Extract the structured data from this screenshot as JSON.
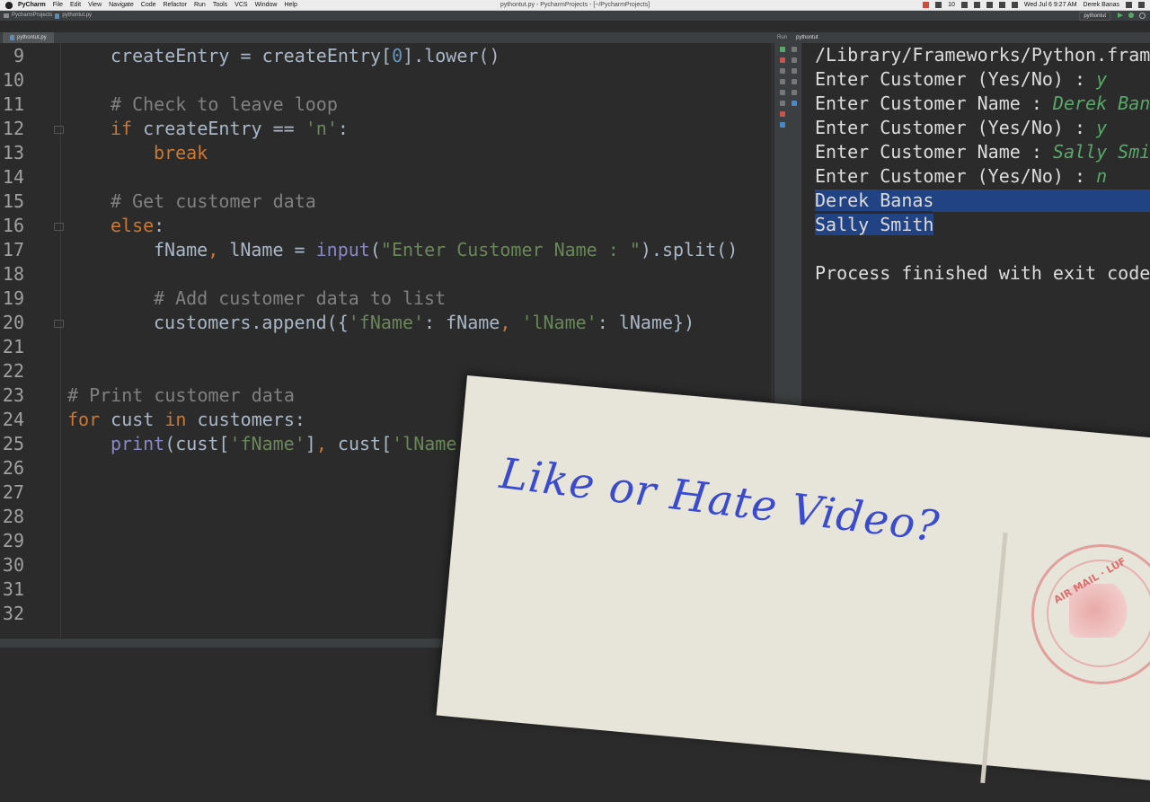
{
  "menubar": {
    "app": "PyCharm",
    "menus": [
      "File",
      "Edit",
      "View",
      "Navigate",
      "Code",
      "Refactor",
      "Run",
      "Tools",
      "VCS",
      "Window",
      "Help"
    ],
    "window_title": "pythontut.py - PycharmProjects - [~/PycharmProjects]",
    "battery_count": "10",
    "datetime": "Wed Jul 6  9:27 AM",
    "user": "Derek Banas"
  },
  "navbar": {
    "project": "PycharmProjects",
    "file": "pythontut.py",
    "run_config": "pythontut"
  },
  "editor": {
    "tab": "pythontut.py",
    "lines": [
      {
        "n": "9",
        "indent": 1,
        "tokens": [
          [
            "plain",
            "createEntry = createEntry["
          ],
          [
            "num",
            "0"
          ],
          [
            "plain",
            "].lower()"
          ]
        ]
      },
      {
        "n": "10",
        "indent": 0,
        "tokens": []
      },
      {
        "n": "11",
        "indent": 1,
        "tokens": [
          [
            "cm",
            "# Check to leave loop"
          ]
        ]
      },
      {
        "n": "12",
        "indent": 1,
        "tokens": [
          [
            "kw",
            "if "
          ],
          [
            "plain",
            "createEntry == "
          ],
          [
            "str",
            "'n'"
          ],
          [
            "plain",
            ":"
          ]
        ]
      },
      {
        "n": "13",
        "indent": 2,
        "tokens": [
          [
            "kw",
            "break"
          ]
        ]
      },
      {
        "n": "14",
        "indent": 0,
        "tokens": []
      },
      {
        "n": "15",
        "indent": 1,
        "tokens": [
          [
            "cm",
            "# Get customer data"
          ]
        ]
      },
      {
        "n": "16",
        "indent": 1,
        "tokens": [
          [
            "kw",
            "else"
          ],
          [
            "plain",
            ":"
          ]
        ]
      },
      {
        "n": "17",
        "indent": 2,
        "tokens": [
          [
            "plain",
            "fName"
          ],
          [
            "kw",
            ", "
          ],
          [
            "plain",
            "lName = "
          ],
          [
            "bi",
            "input"
          ],
          [
            "plain",
            "("
          ],
          [
            "str",
            "\"Enter Customer Name : \""
          ],
          [
            "plain",
            ").split()"
          ]
        ]
      },
      {
        "n": "18",
        "indent": 0,
        "tokens": []
      },
      {
        "n": "19",
        "indent": 2,
        "tokens": [
          [
            "cm",
            "# Add customer data to list"
          ]
        ]
      },
      {
        "n": "20",
        "indent": 2,
        "tokens": [
          [
            "plain",
            "customers.append({"
          ],
          [
            "str",
            "'fName'"
          ],
          [
            "plain",
            ": fName"
          ],
          [
            "kw",
            ", "
          ],
          [
            "str",
            "'lName'"
          ],
          [
            "plain",
            ": lName})"
          ]
        ]
      },
      {
        "n": "21",
        "indent": 0,
        "tokens": []
      },
      {
        "n": "22",
        "indent": 0,
        "tokens": []
      },
      {
        "n": "23",
        "indent": 0,
        "tokens": [
          [
            "cm",
            "# Print customer data"
          ]
        ]
      },
      {
        "n": "24",
        "indent": 0,
        "tokens": [
          [
            "kw",
            "for "
          ],
          [
            "plain",
            "cust "
          ],
          [
            "kw",
            "in "
          ],
          [
            "plain",
            "customers:"
          ]
        ]
      },
      {
        "n": "25",
        "indent": 1,
        "tokens": [
          [
            "bi",
            "print"
          ],
          [
            "plain",
            "(cust["
          ],
          [
            "str",
            "'fName'"
          ],
          [
            "plain",
            "]"
          ],
          [
            "kw",
            ", "
          ],
          [
            "plain",
            "cust["
          ],
          [
            "str",
            "'lName'"
          ],
          [
            "plain",
            "]"
          ]
        ]
      },
      {
        "n": "26",
        "indent": 0,
        "tokens": []
      },
      {
        "n": "27",
        "indent": 0,
        "tokens": []
      },
      {
        "n": "28",
        "indent": 0,
        "tokens": []
      },
      {
        "n": "29",
        "indent": 0,
        "tokens": []
      },
      {
        "n": "30",
        "indent": 0,
        "tokens": []
      },
      {
        "n": "31",
        "indent": 0,
        "tokens": []
      },
      {
        "n": "32",
        "indent": 0,
        "tokens": []
      }
    ]
  },
  "run_panel": {
    "label": "Run",
    "tab": "pythontut",
    "console": [
      {
        "text": "/Library/Frameworks/Python.fram",
        "input": ""
      },
      {
        "text": "Enter Customer (Yes/No) : ",
        "input": "y"
      },
      {
        "text": "Enter Customer Name : ",
        "input": "Derek Bana"
      },
      {
        "text": "Enter Customer (Yes/No) : ",
        "input": "y"
      },
      {
        "text": "Enter Customer Name : ",
        "input": "Sally Smi"
      },
      {
        "text": "Enter Customer (Yes/No) : ",
        "input": "n"
      },
      {
        "text": "Derek Banas",
        "input": "",
        "selected": true
      },
      {
        "text": "Sally Smith",
        "input": "",
        "selected": true
      },
      {
        "text": "",
        "input": ""
      },
      {
        "text": "Process finished with exit code",
        "input": ""
      }
    ]
  },
  "overlay": {
    "postcard_text": "Like or Hate Video?",
    "stamp_text": "AIR MAIL · LUF"
  },
  "colors": {
    "keyword": "#cc7832",
    "string": "#6a8759",
    "comment": "#808080",
    "number": "#6897bb",
    "builtin": "#8888c6",
    "selection": "#214283"
  }
}
